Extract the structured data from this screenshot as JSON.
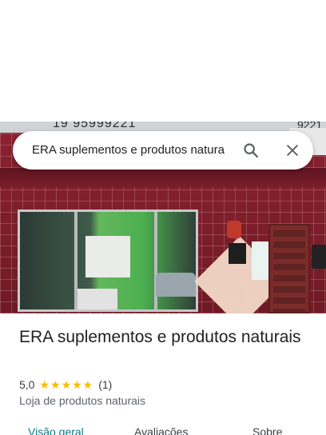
{
  "search": {
    "query": "ERA suplementos e produtos natura",
    "search_icon": "search-icon",
    "close_icon": "close-icon"
  },
  "photo": {
    "sign_phone": "19 95999221",
    "sign_phone_right": "9221"
  },
  "place": {
    "name": "ERA suplementos e produtos naturais",
    "rating": "5,0",
    "stars": "★★★★★",
    "review_count": "(1)",
    "category": "Loja de produtos naturais"
  },
  "tabs": [
    {
      "label": "Visão geral",
      "active": true
    },
    {
      "label": "Avaliações",
      "active": false
    },
    {
      "label": "Sobre",
      "active": false
    }
  ],
  "colors": {
    "accent": "#0b7d85",
    "star": "#fbbc04"
  }
}
